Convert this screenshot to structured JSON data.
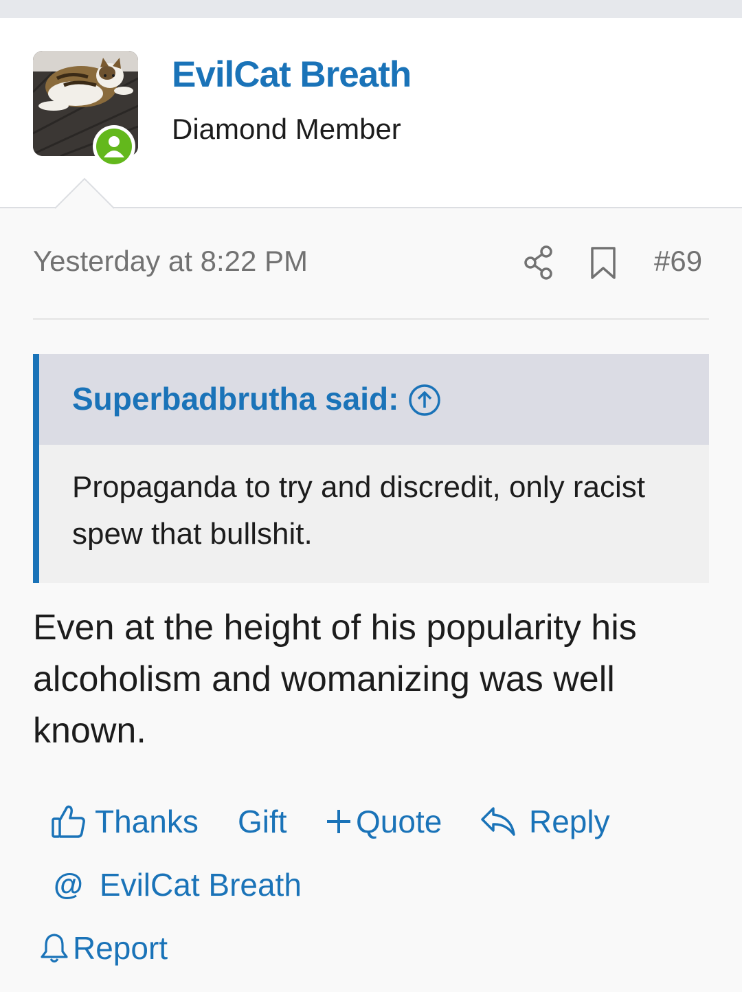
{
  "post": {
    "author": "EvilCat Breath",
    "user_title": "Diamond Member",
    "date": "Yesterday at 8:22 PM",
    "post_number": "#69",
    "quote": {
      "author_line": "Superbadbrutha said:",
      "text": "Propaganda to try and discredit, only racist spew that bullshit."
    },
    "message": "Even at the height of his popularity his alcoholism and womanizing was well known."
  },
  "actions": {
    "thanks": "Thanks",
    "gift": "Gift",
    "quote": "Quote",
    "reply": "Reply",
    "mention": "EvilCat Breath",
    "report": "Report"
  },
  "icons": {
    "avatar": "avatar-cat-photo",
    "online": "user-online-icon",
    "share": "share-icon",
    "bookmark": "bookmark-icon",
    "quote_jump": "arrow-up-circle-icon",
    "thanks": "thumbs-up-icon",
    "quote_add": "plus-icon",
    "reply": "reply-arrow-icon",
    "mention": "at-icon",
    "report": "bell-icon"
  },
  "colors": {
    "link": "#1a73b8",
    "online": "#63b81c",
    "meta_text": "#727272",
    "quote_header_bg": "#dbdce4",
    "quote_bg": "#f0f0f0"
  }
}
